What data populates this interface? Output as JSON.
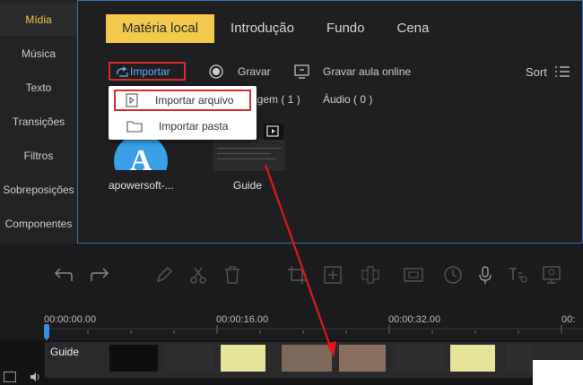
{
  "sidebar": {
    "items": [
      {
        "label": "Mídia",
        "active": true
      },
      {
        "label": "Música"
      },
      {
        "label": "Texto"
      },
      {
        "label": "Transições"
      },
      {
        "label": "Filtros"
      },
      {
        "label": "Sobreposições"
      },
      {
        "label": "Componentes"
      }
    ]
  },
  "tabs": [
    {
      "label": "Matéria local",
      "active": true
    },
    {
      "label": "Introdução"
    },
    {
      "label": "Fundo"
    },
    {
      "label": "Cena"
    }
  ],
  "toolbar": {
    "import_label": "Importar",
    "record_label": "Gravar",
    "record_online_label": "Gravar aula online",
    "sort_label": "Sort"
  },
  "dropdown": {
    "import_file": "Importar arquivo",
    "import_folder": "Importar pasta"
  },
  "filters": {
    "image_label": "agem ( 1 )",
    "audio_label": "Áudio ( 0 )"
  },
  "media": [
    {
      "label": "apowersoft-..."
    },
    {
      "label": "Guide"
    }
  ],
  "timeline": {
    "times": [
      "00:00:00.00",
      "00:00:16.00",
      "00:00:32.00",
      "00:"
    ],
    "clip_label": "Guide"
  },
  "colors": {
    "accent": "#f2c94c",
    "highlight_border": "#d92b2b",
    "link_blue": "#5ab0ff",
    "arrow": "#e01818"
  }
}
